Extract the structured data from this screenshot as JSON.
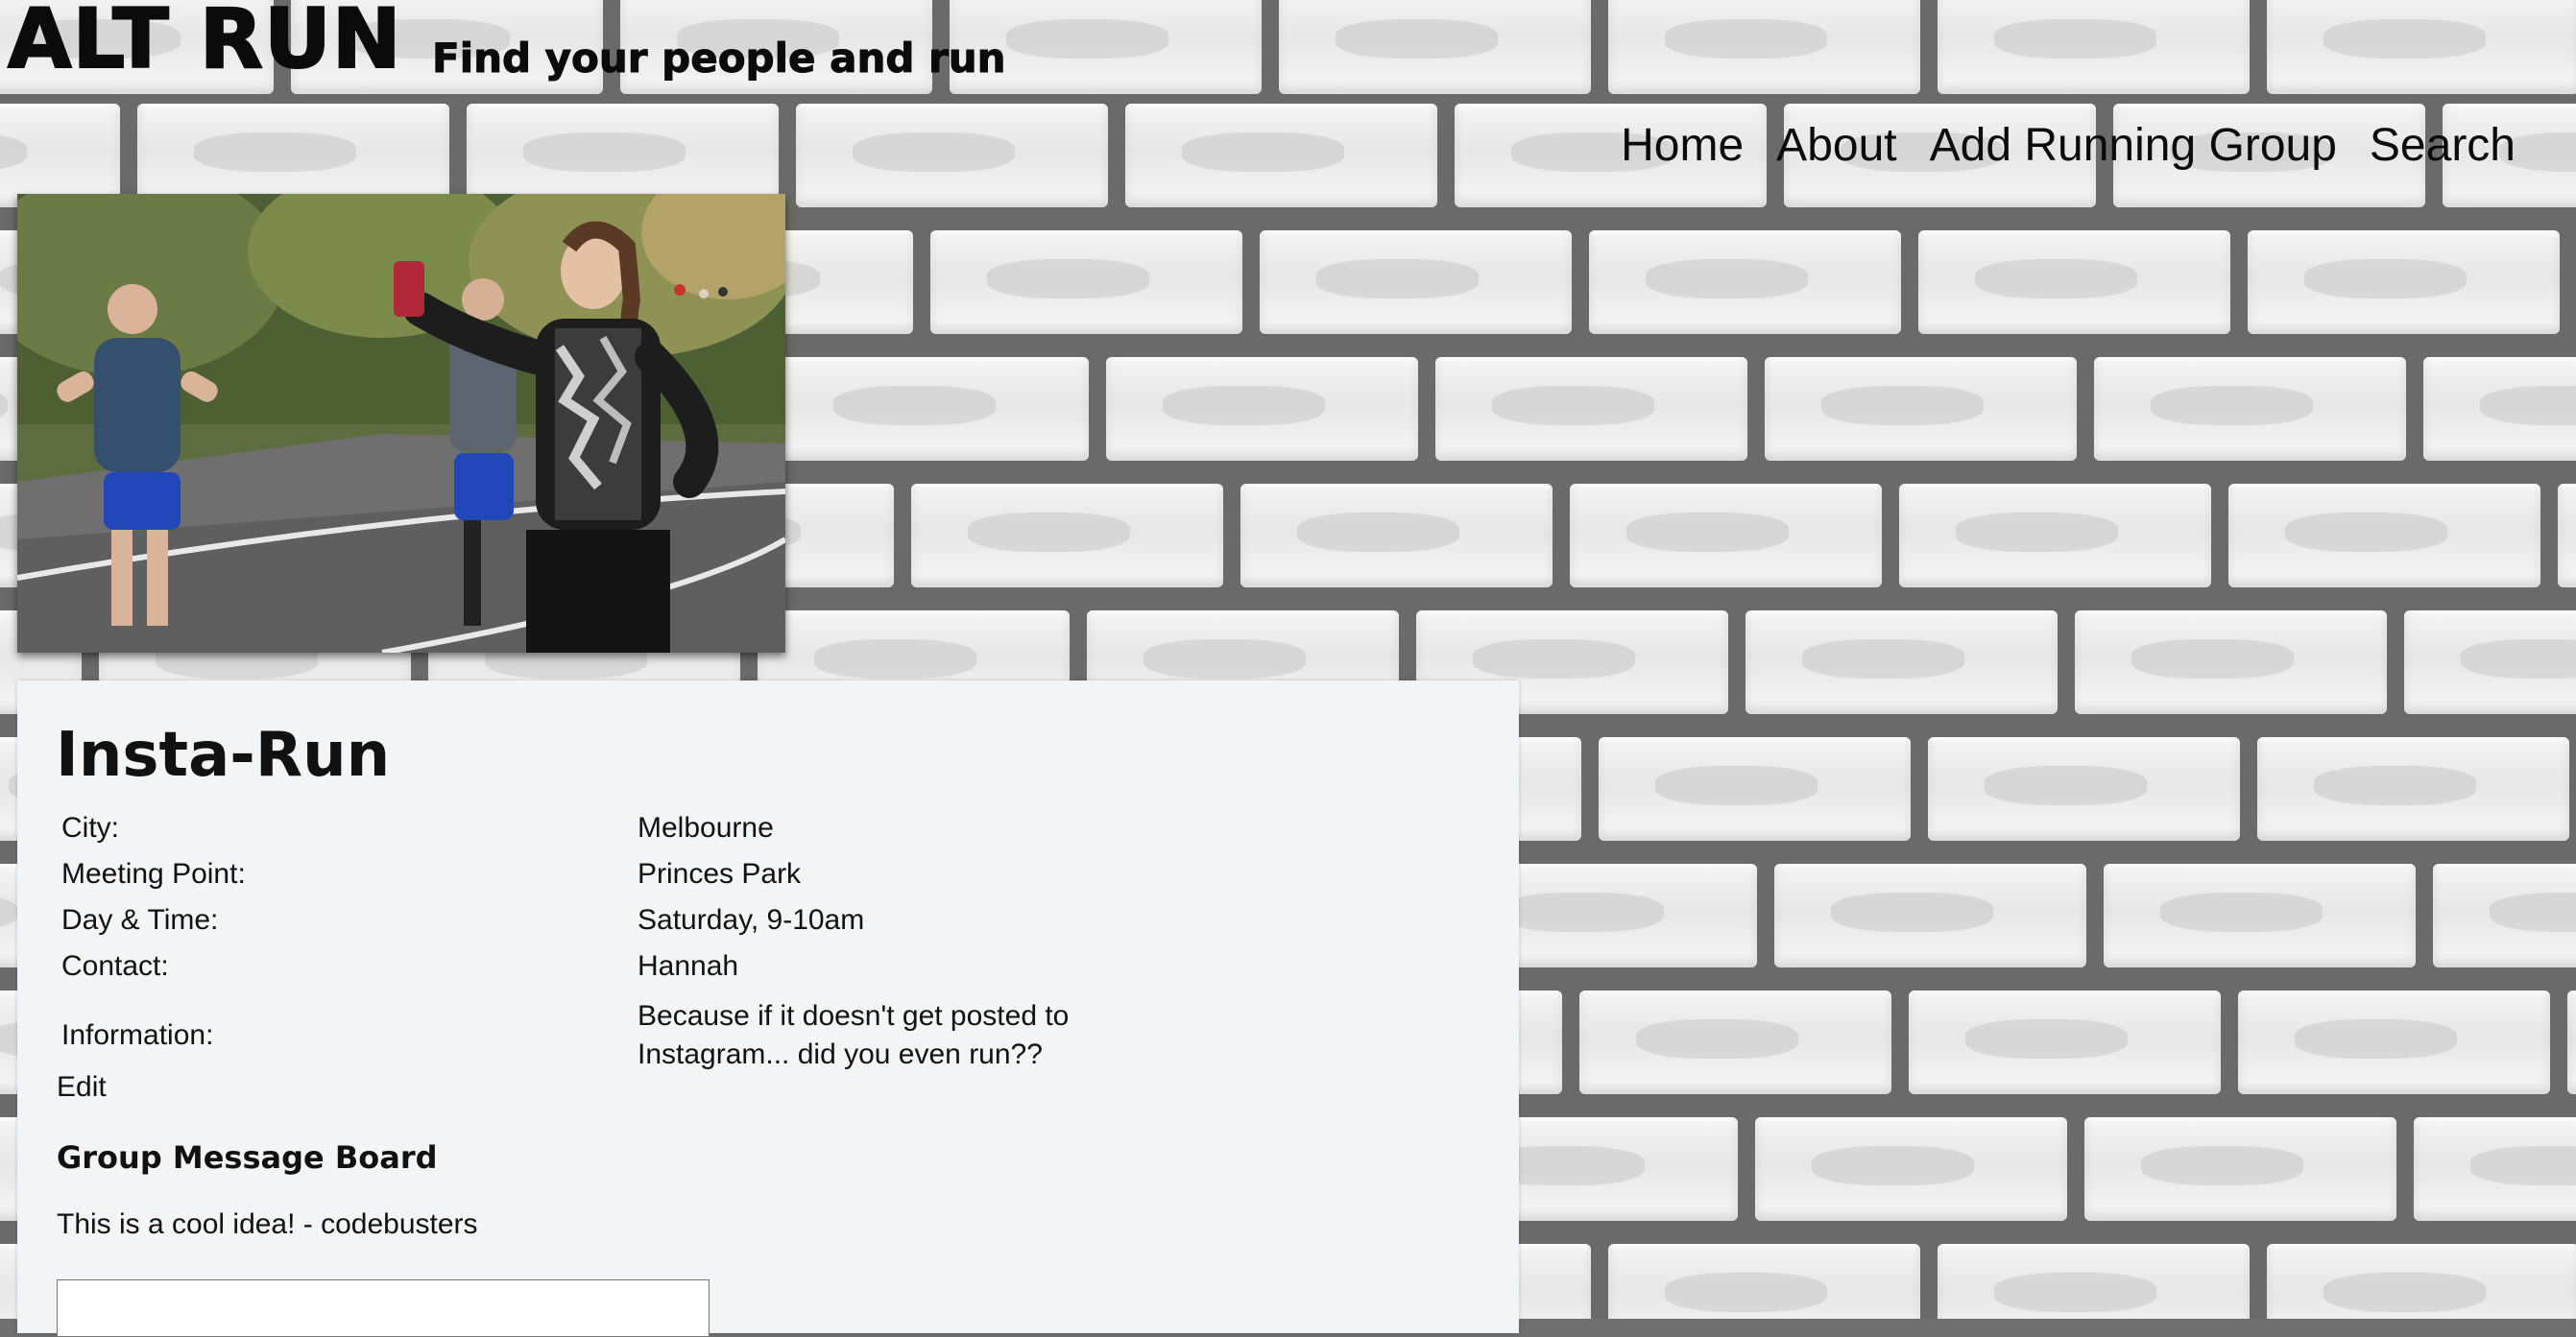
{
  "site": {
    "title": "ALT RUN",
    "tagline": "Find your people and run"
  },
  "nav": {
    "items": [
      {
        "label": "Home"
      },
      {
        "label": "About"
      },
      {
        "label": "Add Running Group"
      },
      {
        "label": "Search"
      }
    ]
  },
  "group": {
    "name": "Insta-Run",
    "details": [
      {
        "label": "City:",
        "value": "Melbourne"
      },
      {
        "label": "Meeting Point:",
        "value": "Princes Park"
      },
      {
        "label": "Day & Time:",
        "value": "Saturday, 9-10am"
      },
      {
        "label": "Contact:",
        "value": "Hannah"
      },
      {
        "label": "Information:",
        "value": "Because if it doesn't get posted to Instagram... did you even run??"
      }
    ],
    "edit_label": "Edit"
  },
  "message_board": {
    "heading": "Group Message Board",
    "messages": [
      {
        "text": "This is a cool idea! - codebusters"
      }
    ],
    "input_value": ""
  },
  "colors": {
    "text": "#111111",
    "card_background": "#f3f4f5",
    "brick": "#eeeeee",
    "mortar": "#6a6a6a"
  }
}
